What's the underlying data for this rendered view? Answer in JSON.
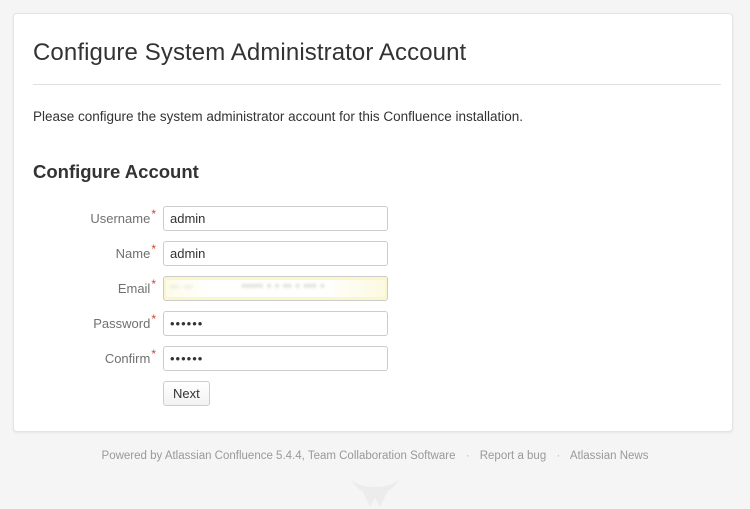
{
  "page": {
    "title": "Configure System Administrator Account",
    "intro": "Please configure the system administrator account for this Confluence installation.",
    "section_heading": "Configure Account",
    "background_color": "#f5f5f5",
    "card_background": "#ffffff",
    "required_mark": "*",
    "required_color": "#d04437"
  },
  "form": {
    "fields": [
      {
        "label": "Username",
        "name": "username",
        "type": "text",
        "value": "admin",
        "placeholder": "",
        "required": true,
        "autofilled": false
      },
      {
        "label": "Name",
        "name": "fullName",
        "type": "text",
        "value": "admin",
        "placeholder": "",
        "required": true,
        "autofilled": false
      },
      {
        "label": "Email",
        "name": "email",
        "type": "text",
        "value": "",
        "placeholder": "",
        "required": true,
        "autofilled": true,
        "autofill_color": "#faf7cf",
        "redacted": true,
        "redacted_hint_left": "—  —",
        "redacted_hint_right": "••••• • • •• • •••  •"
      },
      {
        "label": "Password",
        "name": "password",
        "type": "password",
        "value": "••••••",
        "placeholder": "",
        "required": true,
        "autofilled": false
      },
      {
        "label": "Confirm",
        "name": "confirm",
        "type": "password",
        "value": "••••••",
        "placeholder": "",
        "required": true,
        "autofilled": false
      }
    ],
    "submit_label": "Next"
  },
  "footer": {
    "powered_by": "Powered by Atlassian Confluence 5.4.4, Team Collaboration Software",
    "separator": "·",
    "report_bug": "Report a bug",
    "atlassian_news": "Atlassian News",
    "watermark_icon": "atlassian-logo-icon"
  }
}
